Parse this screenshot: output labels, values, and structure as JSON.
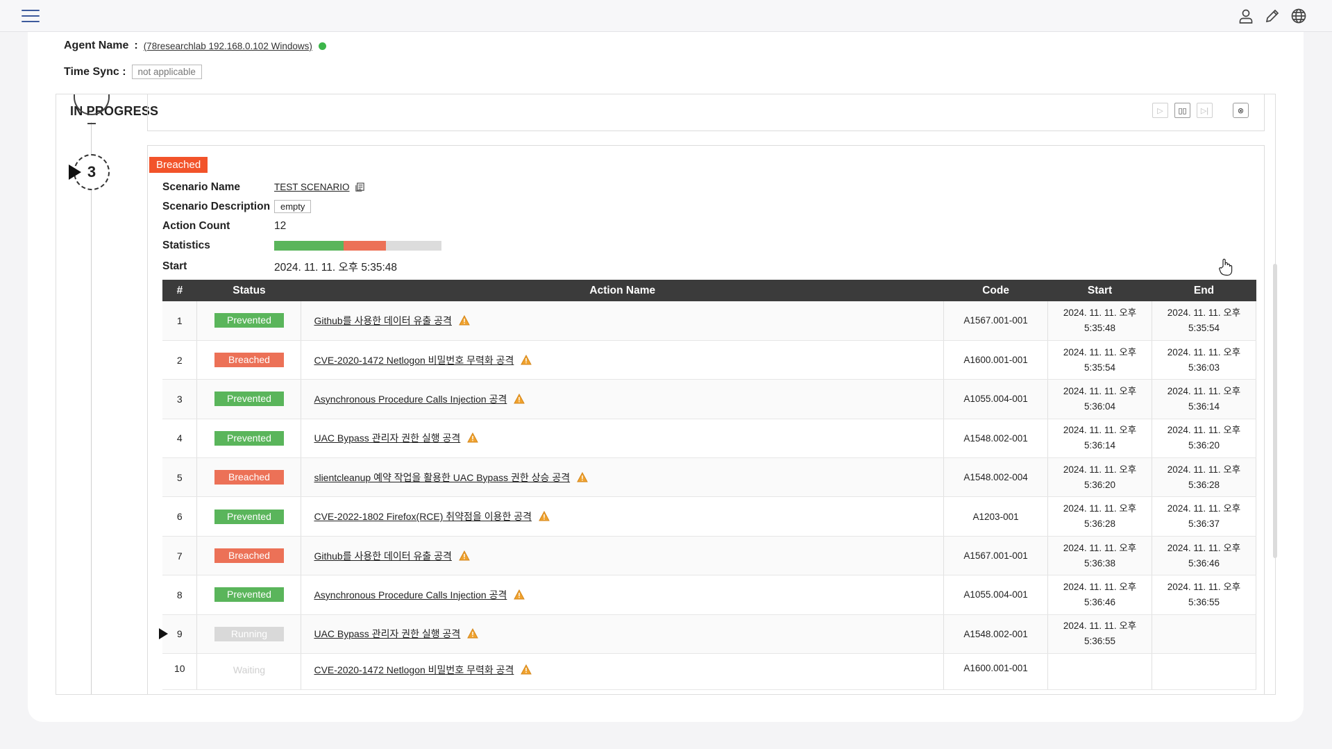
{
  "header": {
    "menu_icon": "hamburger-menu-icon",
    "icons": [
      "user-icon",
      "pencil-icon",
      "globe-icon"
    ]
  },
  "agent": {
    "label": "Agent Name",
    "separator": ":",
    "value": "(78researchlab 192.168.0.102 Windows)",
    "status_color": "#3cb54a"
  },
  "time_sync": {
    "label": "Time Sync :",
    "value": "not applicable"
  },
  "panel": {
    "title": "IN PROGRESS",
    "controls": [
      "play-icon",
      "pause-icon",
      "skip-icon",
      "close-circle-icon"
    ]
  },
  "step": {
    "number": "3",
    "status_tag": "Breached",
    "status_tag_color": "#f2532a"
  },
  "scenario": {
    "name_label": "Scenario Name",
    "name_value": "TEST SCENARIO",
    "description_label": "Scenario Description",
    "description_value": "empty",
    "action_count_label": "Action Count",
    "action_count_value": "12",
    "statistics_label": "Statistics",
    "statistics": {
      "prevented": 5,
      "breached": 3,
      "pending": 4,
      "total": 12
    },
    "start_label": "Start",
    "start_value": "2024. 11. 11. 오후 5:35:48"
  },
  "table": {
    "headers": [
      "#",
      "Status",
      "Action Name",
      "Code",
      "Start",
      "End"
    ],
    "rows": [
      {
        "idx": "1",
        "status": "Prevented",
        "name": "Github를 사용한 데이터 유출 공격",
        "code": "A1567.001-001",
        "start1": "2024. 11. 11. 오후",
        "start2": "5:35:48",
        "end1": "2024. 11. 11. 오후",
        "end2": "5:35:54"
      },
      {
        "idx": "2",
        "status": "Breached",
        "name": "CVE-2020-1472 Netlogon 비밀번호 무력화 공격",
        "code": "A1600.001-001",
        "start1": "2024. 11. 11. 오후",
        "start2": "5:35:54",
        "end1": "2024. 11. 11. 오후",
        "end2": "5:36:03"
      },
      {
        "idx": "3",
        "status": "Prevented",
        "name": "Asynchronous Procedure Calls Injection 공격",
        "code": "A1055.004-001",
        "start1": "2024. 11. 11. 오후",
        "start2": "5:36:04",
        "end1": "2024. 11. 11. 오후",
        "end2": "5:36:14"
      },
      {
        "idx": "4",
        "status": "Prevented",
        "name": "UAC Bypass 관리자 권한 실행 공격",
        "code": "A1548.002-001",
        "start1": "2024. 11. 11. 오후",
        "start2": "5:36:14",
        "end1": "2024. 11. 11. 오후",
        "end2": "5:36:20"
      },
      {
        "idx": "5",
        "status": "Breached",
        "name": "slientcleanup 예약 작업을 활용한 UAC Bypass 권한 상승 공격",
        "code": "A1548.002-004",
        "start1": "2024. 11. 11. 오후",
        "start2": "5:36:20",
        "end1": "2024. 11. 11. 오후",
        "end2": "5:36:28"
      },
      {
        "idx": "6",
        "status": "Prevented",
        "name": "CVE-2022-1802 Firefox(RCE) 취약점을 이용한 공격",
        "code": "A1203-001",
        "start1": "2024. 11. 11. 오후",
        "start2": "5:36:28",
        "end1": "2024. 11. 11. 오후",
        "end2": "5:36:37"
      },
      {
        "idx": "7",
        "status": "Breached",
        "name": "Github를 사용한 데이터 유출 공격",
        "code": "A1567.001-001",
        "start1": "2024. 11. 11. 오후",
        "start2": "5:36:38",
        "end1": "2024. 11. 11. 오후",
        "end2": "5:36:46"
      },
      {
        "idx": "8",
        "status": "Prevented",
        "name": "Asynchronous Procedure Calls Injection 공격",
        "code": "A1055.004-001",
        "start1": "2024. 11. 11. 오후",
        "start2": "5:36:46",
        "end1": "2024. 11. 11. 오후",
        "end2": "5:36:55"
      },
      {
        "idx": "9",
        "status": "Running",
        "name": "UAC Bypass 관리자 권한 실행 공격",
        "code": "A1548.002-001",
        "start1": "2024. 11. 11. 오후",
        "start2": "5:36:55",
        "end1": "",
        "end2": "",
        "current": true
      },
      {
        "idx": "10",
        "status": "Waiting",
        "name": "CVE-2020-1472 Netlogon 비밀번호 무력화 공격",
        "code": "A1600.001-001",
        "start1": "",
        "start2": "",
        "end1": "",
        "end2": ""
      }
    ],
    "status_colors": {
      "Prevented": "#5ab55b",
      "Breached": "#ec7157",
      "Running": "#d9d9d9",
      "Waiting": "#cfcfcf"
    },
    "warning_icon": "warning-triangle-icon"
  }
}
